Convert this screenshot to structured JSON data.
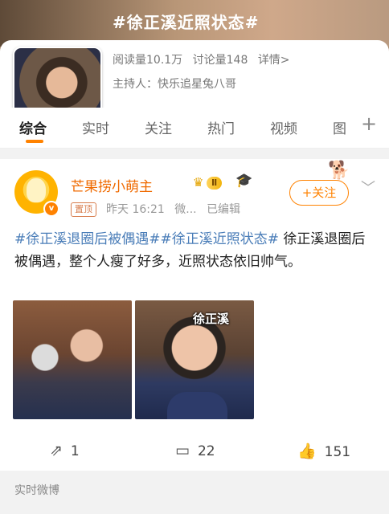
{
  "topic": {
    "title": "#徐正溪近照状态#",
    "read_count": "阅读量10.1万",
    "discuss_count": "讨论量148",
    "details_label": "详情>",
    "host_label": "主持人：快乐追星兔八哥"
  },
  "tabs": [
    {
      "label": "综合"
    },
    {
      "label": "实时"
    },
    {
      "label": "关注"
    },
    {
      "label": "热门"
    },
    {
      "label": "视频"
    },
    {
      "label": "图"
    }
  ],
  "plus_icon": "+",
  "post": {
    "username": "芒果捞小萌主",
    "level": "Ⅱ",
    "pin_label": "置顶",
    "time": "昨天 16:21",
    "source": "微...",
    "edited": "已编辑",
    "follow_label": "+关注",
    "hashtag1": "#徐正溪退圈后被偶遇#",
    "hashtag2": "#徐正溪近照状态#",
    "text": "徐正溪退圈后被偶遇，整个人瘦了好多，近照状态依旧帅气。",
    "photo_caption": "徐正溪",
    "share_count": "1",
    "comment_count": "22",
    "like_count": "151"
  },
  "footer": {
    "label": "实时微博"
  },
  "colors": {
    "accent": "#ff8200",
    "hashtag": "#4a7db8",
    "username": "#ef6a00"
  }
}
